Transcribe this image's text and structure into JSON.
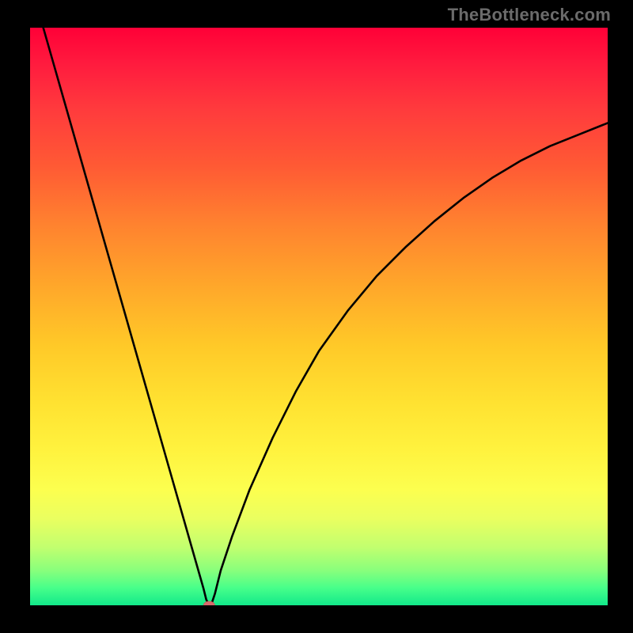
{
  "watermark": {
    "text": "TheBottleneck.com"
  },
  "colors": {
    "page_bg": "#000000",
    "curve": "#000000",
    "marker_fill": "#d86b6d",
    "gradient_top": "#ff0037",
    "gradient_bottom": "#12e98a"
  },
  "chart_data": {
    "type": "line",
    "title": "",
    "xlabel": "",
    "ylabel": "",
    "xlim": [
      0,
      100
    ],
    "ylim": [
      0,
      100
    ],
    "grid": false,
    "legend": false,
    "background": "vertical gradient red→orange→yellow→green",
    "x": [
      0,
      2,
      4,
      6,
      8,
      10,
      12,
      14,
      16,
      18,
      20,
      22,
      24,
      26,
      28,
      30,
      30.5,
      31,
      31.5,
      32,
      33,
      35,
      38,
      42,
      46,
      50,
      55,
      60,
      65,
      70,
      75,
      80,
      85,
      90,
      95,
      100
    ],
    "values": [
      108,
      101,
      94,
      87,
      80,
      73,
      66,
      59,
      52,
      45,
      38,
      31,
      24,
      17,
      10,
      3,
      1,
      0,
      0.5,
      2,
      6,
      12,
      20,
      29,
      37,
      44,
      51,
      57,
      62,
      66.5,
      70.5,
      74,
      77,
      79.5,
      81.5,
      83.5
    ],
    "marker": {
      "x": 31,
      "y": 0
    },
    "notes": "Values approximate bottleneck percentage vs an implicit x-axis parameter; steep linear descent to near-zero at x≈31 then concave-increasing toward ~84 at x=100. Y beyond 100 is clipped by the frame."
  }
}
